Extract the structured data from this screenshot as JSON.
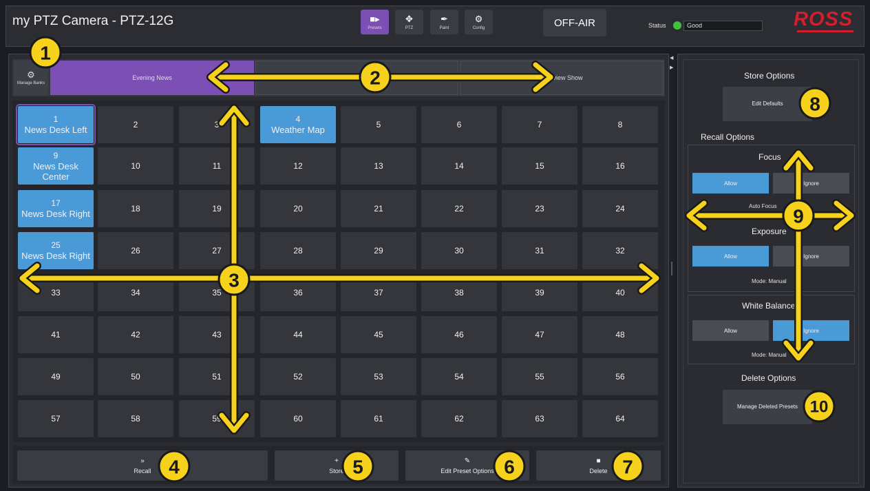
{
  "header": {
    "title": "my PTZ Camera - PTZ-12G",
    "modes": [
      {
        "label": "Presets",
        "icon": "camera-icon",
        "active": true
      },
      {
        "label": "PTZ",
        "icon": "move-icon",
        "active": false
      },
      {
        "label": "Paint",
        "icon": "paint-brush-icon",
        "active": false
      },
      {
        "label": "Config",
        "icon": "gear-icon",
        "active": false
      }
    ],
    "air_state": "OFF-AIR",
    "status_label": "Status",
    "status_value": "Good",
    "status_color": "#3ec23a",
    "logo": "ROSS"
  },
  "banks": {
    "manage_label": "Manage Banks",
    "tabs": [
      {
        "label": "Evening News",
        "active": true
      },
      {
        "label": "",
        "active": false
      },
      {
        "label": "Interview Show",
        "active": false
      }
    ]
  },
  "presets": [
    {
      "num": "1",
      "name": "News Desk Left",
      "stored": true,
      "selected": true
    },
    {
      "num": "2",
      "name": ""
    },
    {
      "num": "3",
      "name": ""
    },
    {
      "num": "4",
      "name": "Weather Map",
      "stored": true
    },
    {
      "num": "5",
      "name": ""
    },
    {
      "num": "6",
      "name": ""
    },
    {
      "num": "7",
      "name": ""
    },
    {
      "num": "8",
      "name": ""
    },
    {
      "num": "9",
      "name": "News Desk Center",
      "stored": true
    },
    {
      "num": "10",
      "name": ""
    },
    {
      "num": "11",
      "name": ""
    },
    {
      "num": "12",
      "name": ""
    },
    {
      "num": "13",
      "name": ""
    },
    {
      "num": "14",
      "name": ""
    },
    {
      "num": "15",
      "name": ""
    },
    {
      "num": "16",
      "name": ""
    },
    {
      "num": "17",
      "name": "News Desk Right",
      "stored": true
    },
    {
      "num": "18",
      "name": ""
    },
    {
      "num": "19",
      "name": ""
    },
    {
      "num": "20",
      "name": ""
    },
    {
      "num": "21",
      "name": ""
    },
    {
      "num": "22",
      "name": ""
    },
    {
      "num": "23",
      "name": ""
    },
    {
      "num": "24",
      "name": ""
    },
    {
      "num": "25",
      "name": "News Desk Right",
      "stored": true
    },
    {
      "num": "26",
      "name": ""
    },
    {
      "num": "27",
      "name": ""
    },
    {
      "num": "28",
      "name": ""
    },
    {
      "num": "29",
      "name": ""
    },
    {
      "num": "30",
      "name": ""
    },
    {
      "num": "31",
      "name": ""
    },
    {
      "num": "32",
      "name": ""
    },
    {
      "num": "33",
      "name": ""
    },
    {
      "num": "34",
      "name": ""
    },
    {
      "num": "35",
      "name": ""
    },
    {
      "num": "36",
      "name": ""
    },
    {
      "num": "37",
      "name": ""
    },
    {
      "num": "38",
      "name": ""
    },
    {
      "num": "39",
      "name": ""
    },
    {
      "num": "40",
      "name": ""
    },
    {
      "num": "41",
      "name": ""
    },
    {
      "num": "42",
      "name": ""
    },
    {
      "num": "43",
      "name": ""
    },
    {
      "num": "44",
      "name": ""
    },
    {
      "num": "45",
      "name": ""
    },
    {
      "num": "46",
      "name": ""
    },
    {
      "num": "47",
      "name": ""
    },
    {
      "num": "48",
      "name": ""
    },
    {
      "num": "49",
      "name": ""
    },
    {
      "num": "50",
      "name": ""
    },
    {
      "num": "51",
      "name": ""
    },
    {
      "num": "52",
      "name": ""
    },
    {
      "num": "53",
      "name": ""
    },
    {
      "num": "54",
      "name": ""
    },
    {
      "num": "55",
      "name": ""
    },
    {
      "num": "56",
      "name": ""
    },
    {
      "num": "57",
      "name": ""
    },
    {
      "num": "58",
      "name": ""
    },
    {
      "num": "59",
      "name": ""
    },
    {
      "num": "60",
      "name": ""
    },
    {
      "num": "61",
      "name": ""
    },
    {
      "num": "62",
      "name": ""
    },
    {
      "num": "63",
      "name": ""
    },
    {
      "num": "64",
      "name": ""
    }
  ],
  "actions": {
    "recall": "Recall",
    "store": "Store",
    "edit": "Edit Preset Options",
    "delete": "Delete"
  },
  "right_panel": {
    "store_options": "Store Options",
    "edit_defaults": "Edit Defaults",
    "recall_options": "Recall Options",
    "focus": {
      "title": "Focus",
      "allow": "Allow",
      "ignore": "Ignore",
      "mode": "Auto Focus",
      "selected": "allow"
    },
    "exposure": {
      "title": "Exposure",
      "allow": "Allow",
      "ignore": "Ignore",
      "mode": "Mode: Manual",
      "selected": "allow"
    },
    "white_balance": {
      "title": "White Balance",
      "allow": "Allow",
      "ignore": "Ignore",
      "mode": "Mode: Manual",
      "selected": "ignore"
    },
    "delete_options": "Delete Options",
    "manage_deleted": "Manage Deleted Presets"
  },
  "callouts": [
    "1",
    "2",
    "3",
    "4",
    "5",
    "6",
    "7",
    "8",
    "9",
    "10"
  ],
  "colors": {
    "accent_purple": "#7b4fb3",
    "stored_blue": "#4b9ad8",
    "callout_yellow": "#f6d21c",
    "logo_red": "#d21f2b"
  }
}
